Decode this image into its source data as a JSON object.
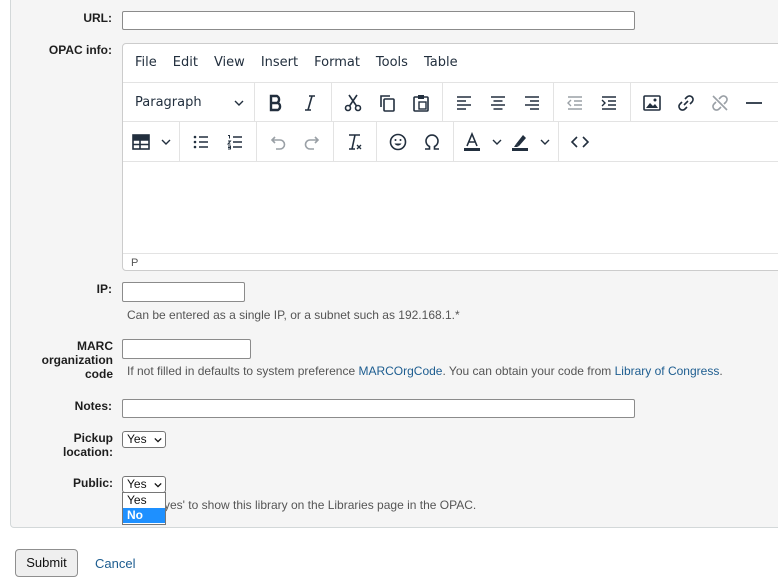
{
  "form": {
    "url_label": "URL:",
    "opac_label": "OPAC info:",
    "ip_label": "IP:",
    "ip_hint": "Can be entered as a single IP, or a subnet such as 192.168.1.*",
    "marc_label_l1": "MARC",
    "marc_label_l2": "organization",
    "marc_label_l3": "code",
    "marc_hint_pre": "If not filled in defaults to system preference ",
    "marc_hint_link1": "MARCOrgCode",
    "marc_hint_mid": ". You can obtain your code from ",
    "marc_hint_link2": "Library of Congress",
    "marc_hint_post": ".",
    "notes_label": "Notes:",
    "pickup_label_l1": "Pickup",
    "pickup_label_l2": "location:",
    "pickup_value": "Yes",
    "public_label": "Public:",
    "public_value": "Yes",
    "public_hint": "yes' to show this library on the Libraries page in the OPAC.",
    "public_options": [
      "Yes",
      "No"
    ]
  },
  "editor": {
    "menus": [
      "File",
      "Edit",
      "View",
      "Insert",
      "Format",
      "Tools",
      "Table"
    ],
    "block_format": "Paragraph",
    "status_path": "P"
  },
  "actions": {
    "submit": "Submit",
    "cancel": "Cancel"
  },
  "colors": {
    "link": "#1d5d90",
    "highlight": "#1e90ff"
  }
}
